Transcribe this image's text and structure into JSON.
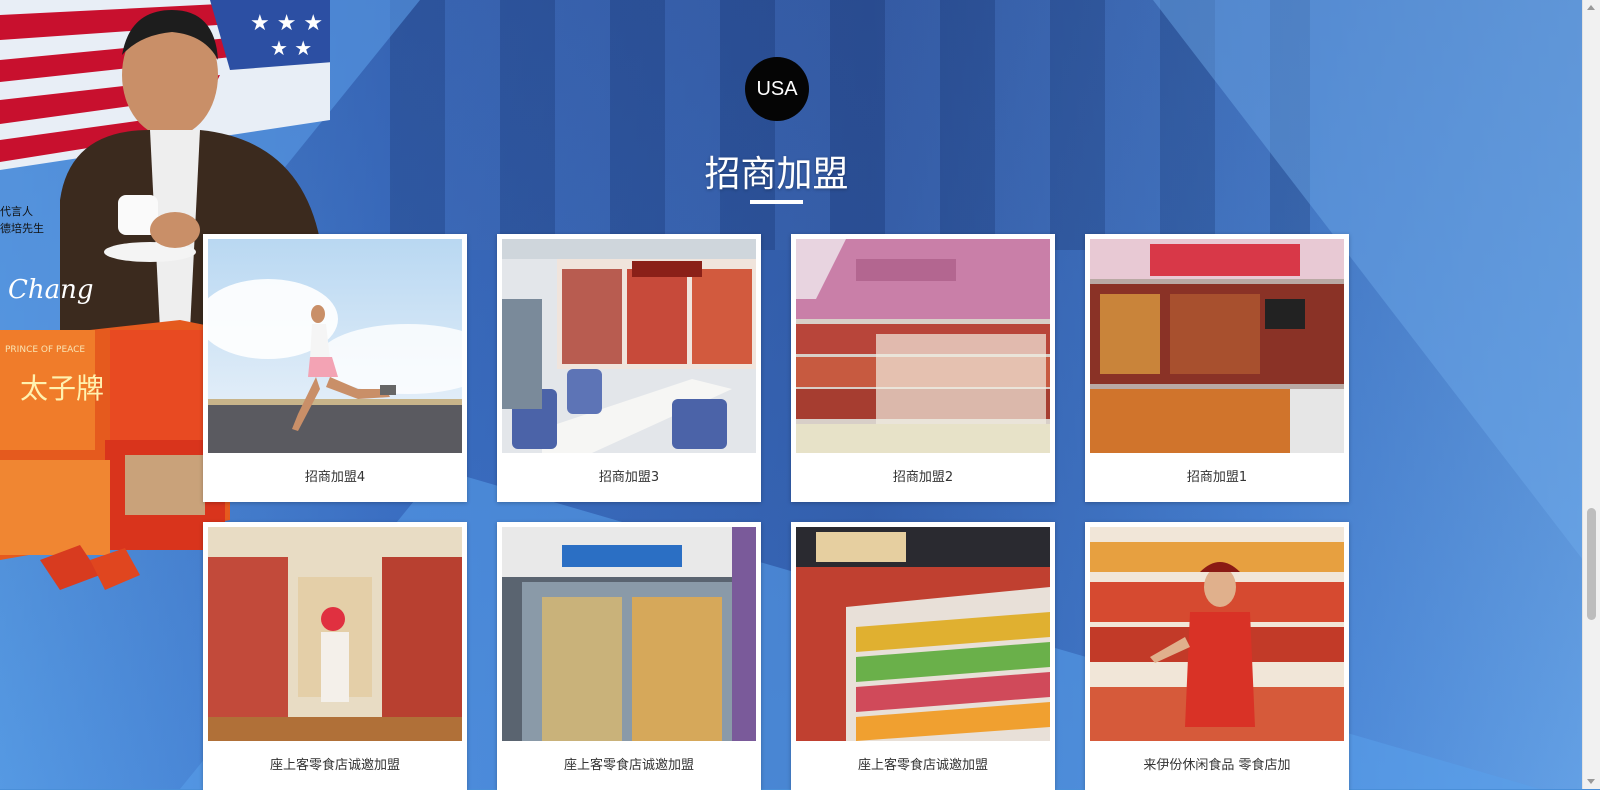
{
  "section": {
    "badge": "USA",
    "title": "招商加盟"
  },
  "ambassador": {
    "line1": "代言人",
    "line2": "德培先生",
    "signature": "Chang",
    "brand_mark": "PRINCE OF PEACE",
    "package_text": "太子牌"
  },
  "cards": [
    {
      "caption": "招商加盟4",
      "image": "runner-photo"
    },
    {
      "caption": "招商加盟3",
      "image": "office-shop-photo"
    },
    {
      "caption": "招商加盟2",
      "image": "store-shelves-photo"
    },
    {
      "caption": "招商加盟1",
      "image": "store-counter-photo"
    },
    {
      "caption": "座上客零食店诚邀加盟",
      "image": "snack-shop-photo"
    },
    {
      "caption": "座上客零食店诚邀加盟",
      "image": "storefront-photo"
    },
    {
      "caption": "座上客零食店诚邀加盟",
      "image": "snack-bins-photo"
    },
    {
      "caption": "来伊份休闲食品 零食店加",
      "image": "clerk-photo"
    }
  ],
  "colors": {
    "accent": "#050505",
    "background": "#4a8fd8"
  }
}
